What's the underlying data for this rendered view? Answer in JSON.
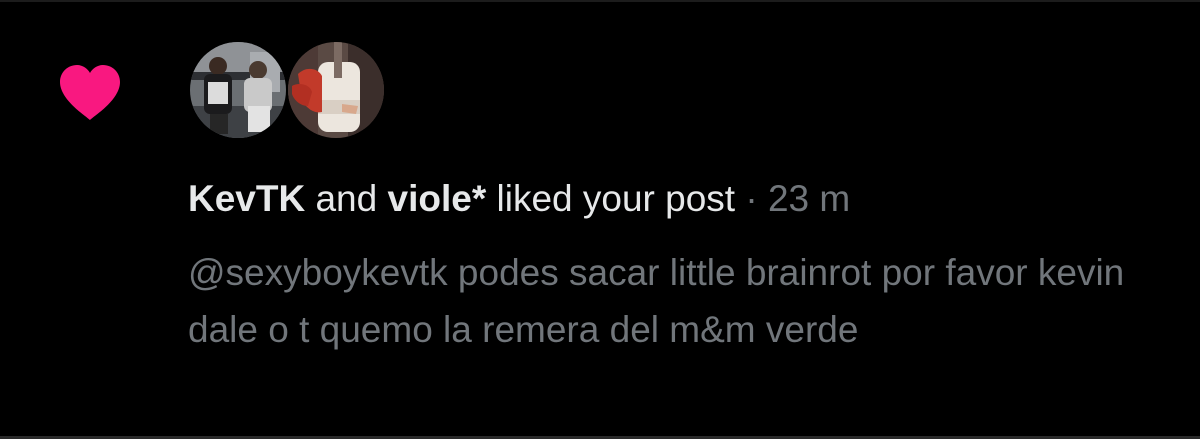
{
  "notification": {
    "type": "like",
    "colors": {
      "heart": "#f91880",
      "primary_text": "#e7e9ea",
      "secondary_text": "#71767b",
      "background": "#000000"
    },
    "avatars": [
      {
        "user": "KevTK",
        "image": "group-photo"
      },
      {
        "user": "viole*",
        "image": "red-hoodie-photo"
      }
    ],
    "headline": {
      "user1": "KevTK",
      "connector": " and ",
      "user2": "viole*",
      "action": " liked your post",
      "separator": " · ",
      "time": "23 m"
    },
    "post_text": "@sexyboykevtk podes sacar little brainrot por favor kevin dale o t quemo la remera del m&m verde"
  }
}
